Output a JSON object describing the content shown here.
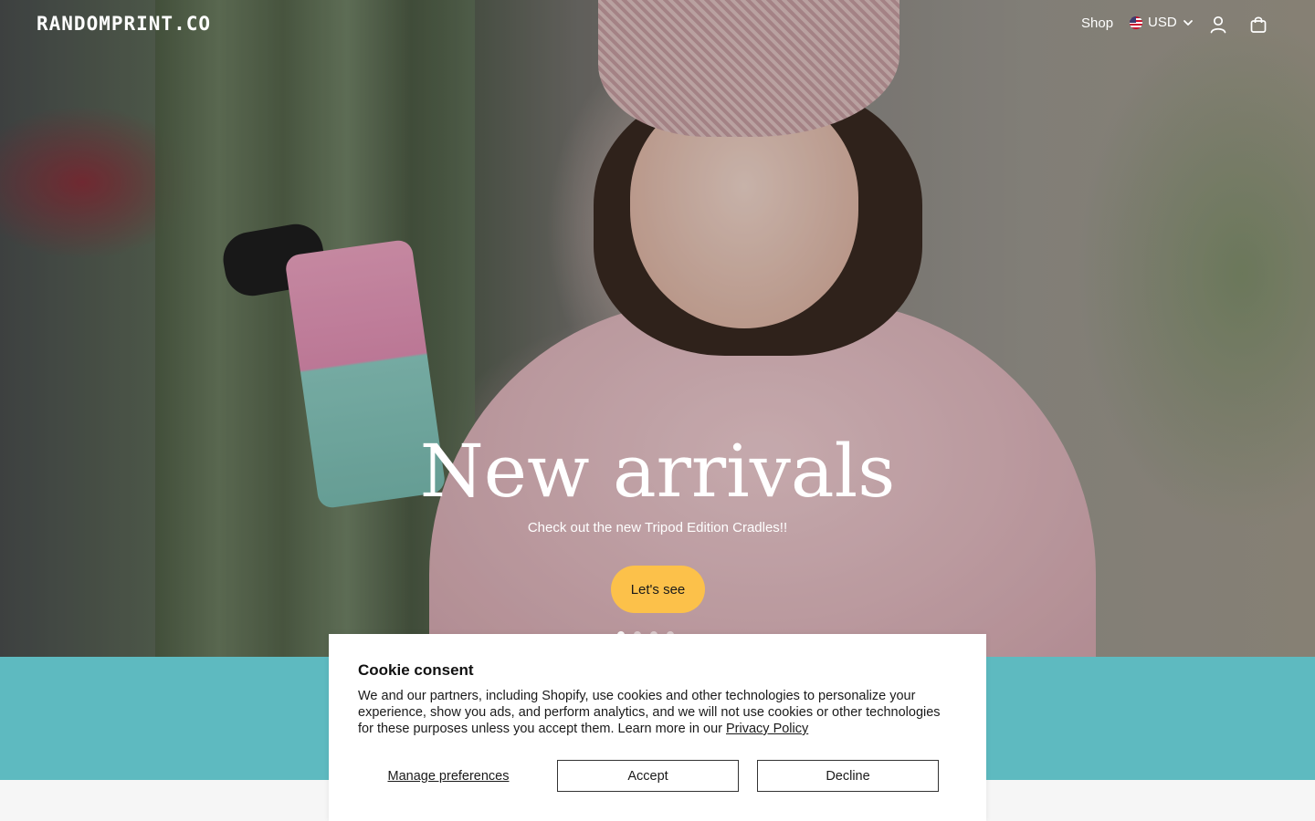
{
  "header": {
    "logo": "RANDOMPRINT.CO",
    "nav_shop": "Shop",
    "currency": "USD",
    "icons": [
      "flag-us-icon",
      "chevron-down-icon",
      "account-icon",
      "cart-icon"
    ]
  },
  "hero": {
    "title": "New arrivals",
    "subtitle": "Check out the new Tripod Edition Cradles!!",
    "cta_label": "Let's see",
    "cta_color": "#fcc14a",
    "slide_count": 4,
    "active_slide": 1
  },
  "band": {
    "color": "#5ebac0"
  },
  "cookie": {
    "title": "Cookie consent",
    "text": "We and our partners, including Shopify, use cookies and other technologies to personalize your experience, show you ads, and perform analytics, and we will not use cookies or other technologies for these purposes unless you accept them. Learn more in our ",
    "link_label": "Privacy Policy",
    "manage_label": "Manage preferences",
    "accept_label": "Accept",
    "decline_label": "Decline"
  }
}
